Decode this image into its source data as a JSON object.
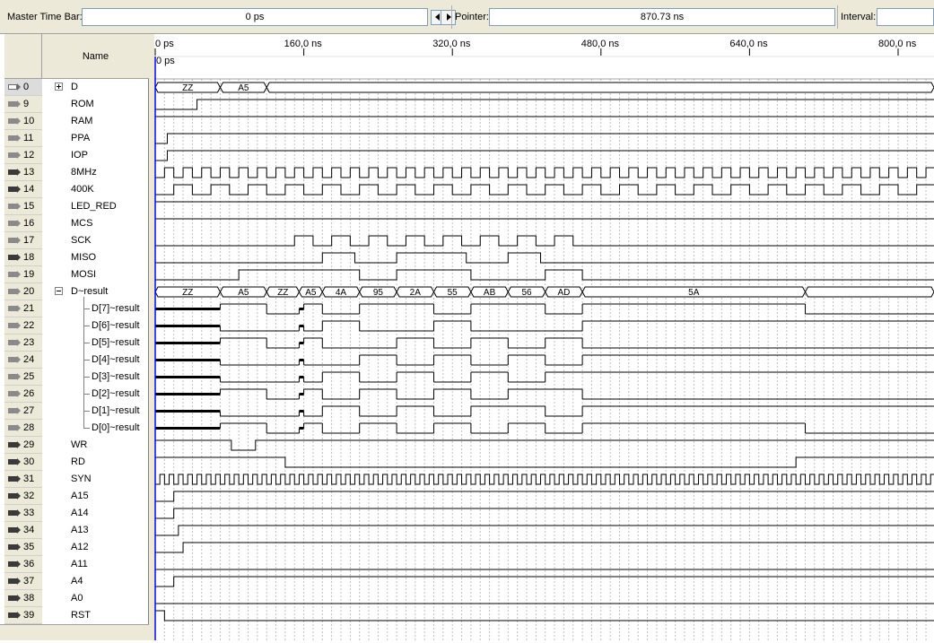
{
  "toolbar": {
    "master_time_bar_label": "Master Time Bar:",
    "master_time_bar_value": "0 ps",
    "pointer_label": "Pointer:",
    "pointer_value": "870.73 ns",
    "interval_label": "Interval:"
  },
  "header": {
    "name_label": "Name",
    "ruler_cursor_label": "0 ps",
    "ruler_ticks": [
      {
        "label": "0 ps",
        "t": 0
      },
      {
        "label": "160,0 ns",
        "t": 160
      },
      {
        "label": "320,0 ns",
        "t": 320
      },
      {
        "label": "480,0 ns",
        "t": 480
      },
      {
        "label": "640,0 ns",
        "t": 640
      },
      {
        "label": "800,0 ns",
        "t": 800
      }
    ]
  },
  "signals": [
    {
      "id": "0",
      "name": "D",
      "icon": "bidir-pin-icon",
      "kind": "bus",
      "expander": "plus",
      "indent": 0,
      "bus": [
        {
          "from": 0,
          "to": 70,
          "label": "ZZ"
        },
        {
          "from": 70,
          "to": 120,
          "label": "A5"
        },
        {
          "from": 120,
          "to": 840,
          "label": ""
        }
      ]
    },
    {
      "id": "9",
      "name": "ROM",
      "icon": "output-pin-icon",
      "kind": "bit",
      "edges": [
        [
          0,
          0
        ],
        [
          45,
          1
        ]
      ]
    },
    {
      "id": "10",
      "name": "RAM",
      "icon": "output-pin-icon",
      "kind": "bit",
      "edges": [
        [
          0,
          1
        ]
      ]
    },
    {
      "id": "11",
      "name": "PPA",
      "icon": "output-pin-icon",
      "kind": "bit",
      "edges": [
        [
          0,
          0
        ],
        [
          13,
          1
        ]
      ]
    },
    {
      "id": "12",
      "name": "IOP",
      "icon": "output-pin-icon",
      "kind": "bit",
      "edges": [
        [
          0,
          0
        ],
        [
          13,
          1
        ]
      ]
    },
    {
      "id": "13",
      "name": "8MHz",
      "icon": "input-pin-icon",
      "kind": "clock",
      "period": 20,
      "phase": 0
    },
    {
      "id": "14",
      "name": "400K",
      "icon": "input-pin-icon",
      "kind": "clock",
      "period": 40,
      "phase": 20
    },
    {
      "id": "15",
      "name": "LED_RED",
      "icon": "output-pin-icon",
      "kind": "bit",
      "edges": [
        [
          0,
          1
        ]
      ]
    },
    {
      "id": "16",
      "name": "MCS",
      "icon": "output-pin-icon",
      "kind": "bit",
      "edges": [
        [
          0,
          1
        ]
      ]
    },
    {
      "id": "17",
      "name": "SCK",
      "icon": "output-pin-icon",
      "kind": "bit",
      "edges": [
        [
          0,
          0
        ],
        [
          150,
          1
        ],
        [
          170,
          0
        ],
        [
          190,
          1
        ],
        [
          210,
          0
        ],
        [
          230,
          1
        ],
        [
          250,
          0
        ],
        [
          270,
          1
        ],
        [
          290,
          0
        ],
        [
          310,
          1
        ],
        [
          330,
          0
        ],
        [
          350,
          1
        ],
        [
          370,
          0
        ],
        [
          390,
          1
        ],
        [
          410,
          0
        ],
        [
          430,
          1
        ],
        [
          450,
          0
        ]
      ]
    },
    {
      "id": "18",
      "name": "MISO",
      "icon": "input-pin-icon",
      "kind": "bit",
      "edges": [
        [
          0,
          0
        ],
        [
          180,
          1
        ],
        [
          215,
          0
        ],
        [
          260,
          1
        ],
        [
          335,
          0
        ],
        [
          380,
          1
        ],
        [
          415,
          0
        ]
      ]
    },
    {
      "id": "19",
      "name": "MOSI",
      "icon": "output-pin-icon",
      "kind": "bit",
      "edges": [
        [
          0,
          0
        ],
        [
          90,
          1
        ],
        [
          220,
          0
        ],
        [
          260,
          1
        ],
        [
          340,
          0
        ],
        [
          420,
          1
        ],
        [
          460,
          0
        ]
      ]
    },
    {
      "id": "20",
      "name": "D~result",
      "icon": "output-pin-icon",
      "kind": "bus",
      "expander": "minus",
      "indent": 0,
      "bus": [
        {
          "from": 0,
          "to": 70,
          "label": "ZZ"
        },
        {
          "from": 70,
          "to": 120,
          "label": "A5"
        },
        {
          "from": 120,
          "to": 155,
          "label": "ZZ"
        },
        {
          "from": 155,
          "to": 180,
          "label": "A5"
        },
        {
          "from": 180,
          "to": 220,
          "label": "4A"
        },
        {
          "from": 220,
          "to": 260,
          "label": "95"
        },
        {
          "from": 260,
          "to": 300,
          "label": "2A"
        },
        {
          "from": 300,
          "to": 340,
          "label": "55"
        },
        {
          "from": 340,
          "to": 380,
          "label": "AB"
        },
        {
          "from": 380,
          "to": 420,
          "label": "56"
        },
        {
          "from": 420,
          "to": 460,
          "label": "AD"
        },
        {
          "from": 460,
          "to": 700,
          "label": "5A"
        },
        {
          "from": 700,
          "to": 840,
          "label": ""
        }
      ]
    },
    {
      "id": "21",
      "name": "D[7]~result",
      "icon": "output-pin-icon",
      "kind": "bitz",
      "child": true,
      "edges": [
        [
          "z",
          0
        ],
        [
          1,
          70
        ],
        [
          0,
          120
        ],
        [
          "z",
          155
        ],
        [
          1,
          160
        ],
        [
          0,
          180
        ],
        [
          1,
          220
        ],
        [
          0,
          300
        ],
        [
          1,
          340
        ],
        [
          0,
          420
        ],
        [
          1,
          460
        ],
        [
          0,
          700
        ],
        [
          "z",
          840
        ]
      ]
    },
    {
      "id": "22",
      "name": "D[6]~result",
      "icon": "output-pin-icon",
      "kind": "bitz",
      "child": true,
      "edges": [
        [
          "z",
          0
        ],
        [
          0,
          70
        ],
        [
          0,
          120
        ],
        [
          "z",
          155
        ],
        [
          0,
          160
        ],
        [
          1,
          180
        ],
        [
          0,
          220
        ],
        [
          0,
          260
        ],
        [
          1,
          300
        ],
        [
          0,
          340
        ],
        [
          0,
          380
        ],
        [
          1,
          460
        ],
        [
          1,
          700
        ],
        [
          "z",
          840
        ]
      ]
    },
    {
      "id": "23",
      "name": "D[5]~result",
      "icon": "output-pin-icon",
      "kind": "bitz",
      "child": true,
      "edges": [
        [
          "z",
          0
        ],
        [
          1,
          70
        ],
        [
          0,
          120
        ],
        [
          "z",
          155
        ],
        [
          1,
          160
        ],
        [
          0,
          180
        ],
        [
          0,
          220
        ],
        [
          1,
          260
        ],
        [
          0,
          300
        ],
        [
          1,
          340
        ],
        [
          0,
          380
        ],
        [
          1,
          420
        ],
        [
          0,
          460
        ],
        [
          0,
          700
        ],
        [
          "z",
          840
        ]
      ]
    },
    {
      "id": "24",
      "name": "D[4]~result",
      "icon": "output-pin-icon",
      "kind": "bitz",
      "child": true,
      "edges": [
        [
          "z",
          0
        ],
        [
          0,
          70
        ],
        [
          0,
          120
        ],
        [
          "z",
          155
        ],
        [
          0,
          160
        ],
        [
          0,
          180
        ],
        [
          1,
          220
        ],
        [
          0,
          260
        ],
        [
          1,
          300
        ],
        [
          0,
          340
        ],
        [
          1,
          380
        ],
        [
          0,
          420
        ],
        [
          1,
          460
        ],
        [
          1,
          700
        ],
        [
          "z",
          840
        ]
      ]
    },
    {
      "id": "25",
      "name": "D[3]~result",
      "icon": "output-pin-icon",
      "kind": "bitz",
      "child": true,
      "edges": [
        [
          "z",
          0
        ],
        [
          0,
          70
        ],
        [
          0,
          120
        ],
        [
          "z",
          155
        ],
        [
          0,
          160
        ],
        [
          1,
          180
        ],
        [
          0,
          220
        ],
        [
          1,
          260
        ],
        [
          0,
          300
        ],
        [
          1,
          340
        ],
        [
          0,
          380
        ],
        [
          1,
          420
        ],
        [
          1,
          460
        ],
        [
          1,
          700
        ],
        [
          "z",
          840
        ]
      ]
    },
    {
      "id": "26",
      "name": "D[2]~result",
      "icon": "output-pin-icon",
      "kind": "bitz",
      "child": true,
      "edges": [
        [
          "z",
          0
        ],
        [
          1,
          70
        ],
        [
          0,
          120
        ],
        [
          "z",
          155
        ],
        [
          1,
          160
        ],
        [
          0,
          180
        ],
        [
          1,
          220
        ],
        [
          0,
          260
        ],
        [
          1,
          300
        ],
        [
          0,
          340
        ],
        [
          1,
          380
        ],
        [
          0,
          460
        ],
        [
          0,
          700
        ],
        [
          "z",
          840
        ]
      ]
    },
    {
      "id": "27",
      "name": "D[1]~result",
      "icon": "output-pin-icon",
      "kind": "bitz",
      "child": true,
      "edges": [
        [
          "z",
          0
        ],
        [
          0,
          70
        ],
        [
          0,
          120
        ],
        [
          "z",
          155
        ],
        [
          0,
          160
        ],
        [
          1,
          180
        ],
        [
          0,
          220
        ],
        [
          1,
          260
        ],
        [
          0,
          300
        ],
        [
          1,
          340
        ],
        [
          1,
          380
        ],
        [
          0,
          420
        ],
        [
          1,
          460
        ],
        [
          1,
          700
        ],
        [
          "z",
          840
        ]
      ]
    },
    {
      "id": "28",
      "name": "D[0]~result",
      "icon": "output-pin-icon",
      "kind": "bitz",
      "child": true,
      "edges": [
        [
          "z",
          0
        ],
        [
          1,
          70
        ],
        [
          0,
          120
        ],
        [
          "z",
          155
        ],
        [
          1,
          160
        ],
        [
          0,
          180
        ],
        [
          1,
          220
        ],
        [
          0,
          260
        ],
        [
          1,
          300
        ],
        [
          0,
          340
        ],
        [
          1,
          380
        ],
        [
          0,
          420
        ],
        [
          1,
          460
        ],
        [
          0,
          700
        ],
        [
          "z",
          840
        ]
      ]
    },
    {
      "id": "29",
      "name": "WR",
      "icon": "input-pin-icon",
      "kind": "bit",
      "edges": [
        [
          0,
          1
        ],
        [
          82,
          0
        ],
        [
          108,
          1
        ]
      ]
    },
    {
      "id": "30",
      "name": "RD",
      "icon": "input-pin-icon",
      "kind": "bit",
      "edges": [
        [
          0,
          1
        ],
        [
          140,
          0
        ],
        [
          690,
          1
        ]
      ]
    },
    {
      "id": "31",
      "name": "SYN",
      "icon": "input-pin-icon",
      "kind": "clock",
      "period": 10,
      "phase": 5
    },
    {
      "id": "32",
      "name": "A15",
      "icon": "input-pin-icon",
      "kind": "bit",
      "edges": [
        [
          0,
          0
        ],
        [
          20,
          1
        ]
      ]
    },
    {
      "id": "33",
      "name": "A14",
      "icon": "input-pin-icon",
      "kind": "bit",
      "edges": [
        [
          0,
          0
        ],
        [
          20,
          1
        ]
      ]
    },
    {
      "id": "34",
      "name": "A13",
      "icon": "input-pin-icon",
      "kind": "bit",
      "edges": [
        [
          0,
          0
        ],
        [
          25,
          1
        ]
      ]
    },
    {
      "id": "35",
      "name": "A12",
      "icon": "input-pin-icon",
      "kind": "bit",
      "edges": [
        [
          0,
          0
        ],
        [
          30,
          1
        ]
      ]
    },
    {
      "id": "36",
      "name": "A11",
      "icon": "input-pin-icon",
      "kind": "bit",
      "edges": [
        [
          0,
          0
        ],
        [
          30,
          0
        ]
      ]
    },
    {
      "id": "37",
      "name": "A4",
      "icon": "input-pin-icon",
      "kind": "bit",
      "edges": [
        [
          0,
          0
        ],
        [
          20,
          1
        ]
      ]
    },
    {
      "id": "38",
      "name": "A0",
      "icon": "input-pin-icon",
      "kind": "bit",
      "edges": [
        [
          0,
          0
        ]
      ]
    },
    {
      "id": "39",
      "name": "RST",
      "icon": "input-pin-icon",
      "kind": "bit",
      "edges": [
        [
          0,
          1
        ],
        [
          10,
          0
        ]
      ]
    }
  ],
  "colors": {
    "panel_bg": "#ece9d8",
    "wave": "#000000",
    "cursor": "#0000ff",
    "grid": "#c0c0c0"
  }
}
